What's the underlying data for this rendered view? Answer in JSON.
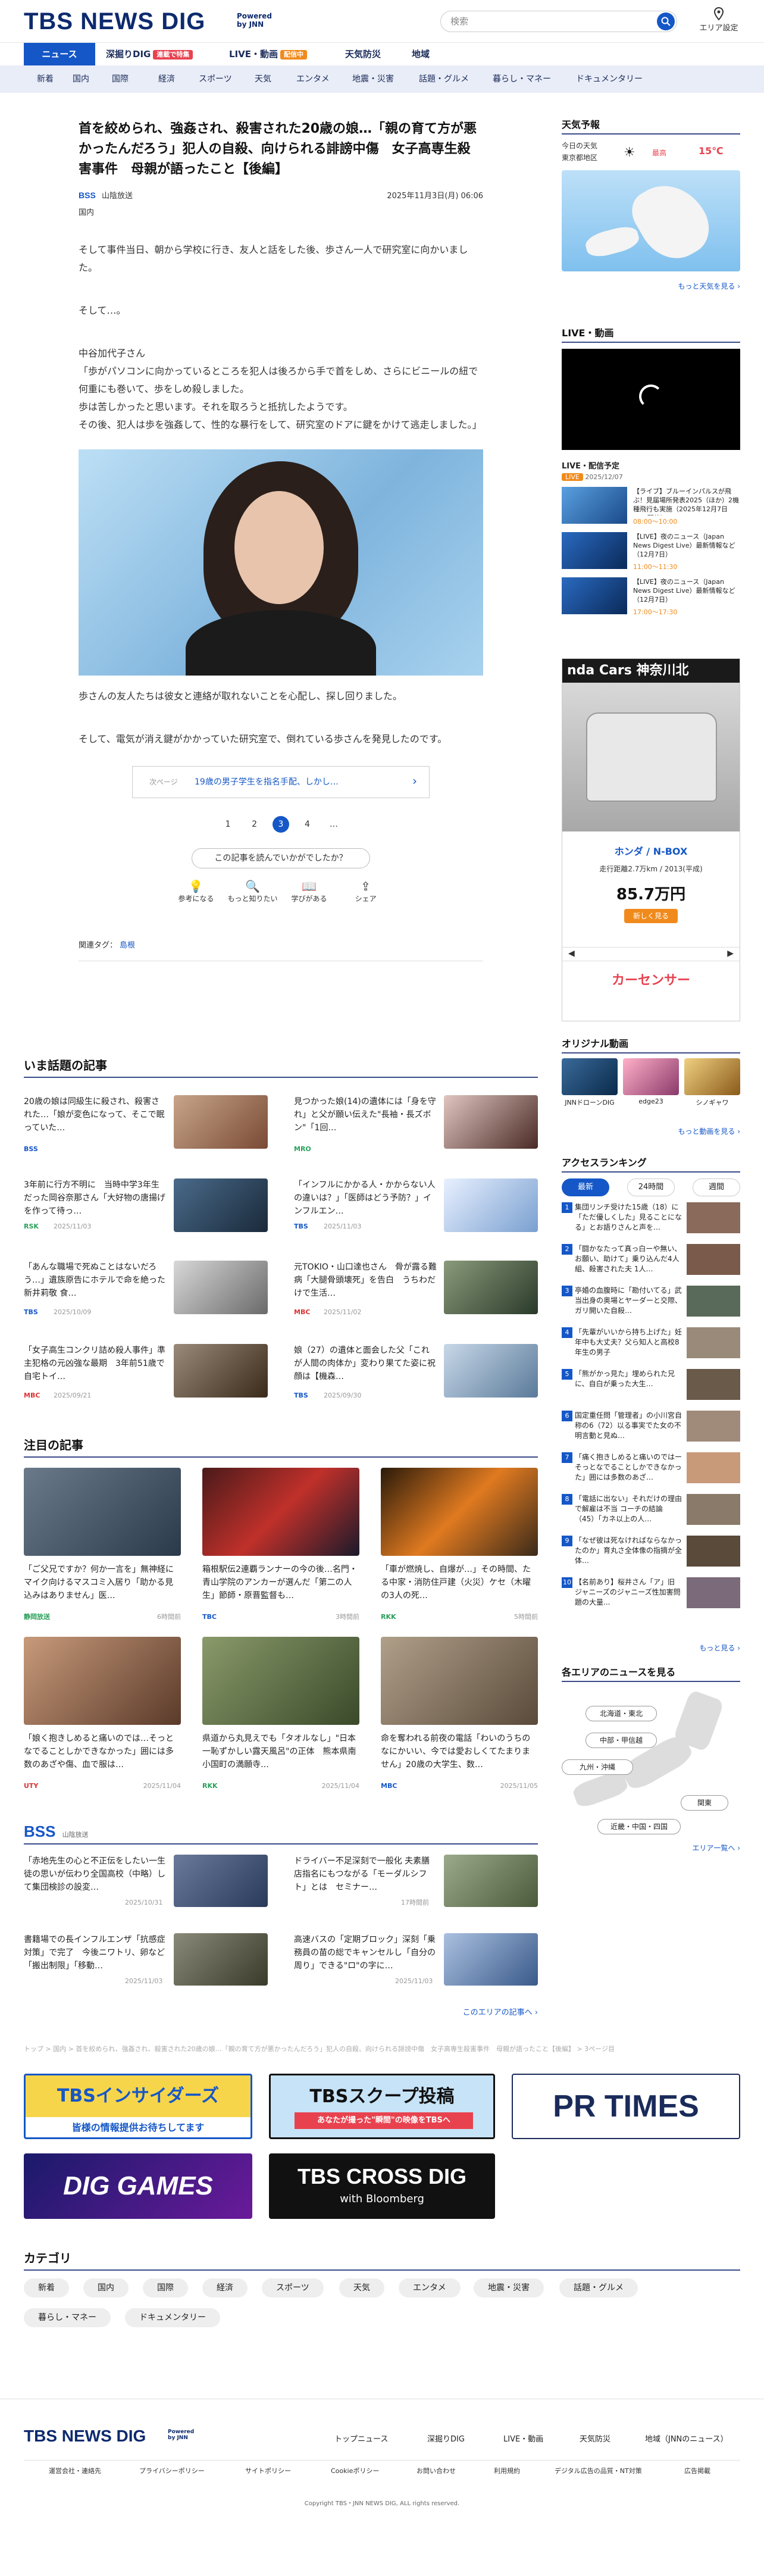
{
  "header": {
    "logo": "TBS NEWS DIG",
    "powered_by": "Powered by JNN",
    "search_placeholder": "検索",
    "area_setting": "エリア設定"
  },
  "nav1": [
    {
      "label": "ニュース"
    },
    {
      "label": "深掘りDIG",
      "badge": "連載で特集"
    },
    {
      "label": "LIVE・動画",
      "badge": "配信中"
    },
    {
      "label": "天気防災"
    },
    {
      "label": "地域"
    }
  ],
  "nav2": [
    "新着",
    "国内",
    "国際",
    "経済",
    "スポーツ",
    "天気",
    "エンタメ",
    "地震・災害",
    "話題・グルメ",
    "暮らし・マネー",
    "ドキュメンタリー"
  ],
  "article": {
    "title": "首を絞められ、強姦され、殺害された20歳の娘…「親の育て方が悪かったんだろう」犯人の自殺、向けられる誹謗中傷　女子高専生殺害事件　母親が語ったこと【後編】",
    "source_logo": "BSS",
    "source": "山陰放送",
    "date": "2025年11月3日(月) 06:06",
    "category": "国内",
    "p1": "そして事件当日、朝から学校に行き、友人と話をした後、歩さん一人で研究室に向かいました。",
    "p2": "そして…。",
    "p3": "中谷加代子さん\n「歩がパソコンに向かっているところを犯人は後ろから手で首をしめ、さらにビニールの紐で何重にも巻いて、歩をしめ殺しました。\n歩は苦しかったと思います。それを取ろうと抵抗したようです。\nその後、犯人は歩を強姦して、性的な暴行をして、研究室のドアに鍵をかけて逃走しました。」",
    "p4": "歩さんの友人たちは彼女と連絡が取れないことを心配し、探し回りました。",
    "p5": "そして、電気が消え鍵がかかっていた研究室で、倒れている歩さんを発見したのです。",
    "next_label": "次ページ",
    "next_text": "19歳の男子学生を指名手配、しかし…",
    "pages": [
      "1",
      "2",
      "3",
      "4",
      "…"
    ],
    "current_page": "3",
    "feedback_question": "この記事を読んでいかがでしたか？",
    "reactions": [
      "参考になる",
      "もっと知りたい",
      "学びがある",
      "シェア"
    ],
    "tags_label": "関連タグ：",
    "tag": "島根"
  },
  "trending": {
    "title": "いま話題の記事",
    "items": [
      {
        "text": "20歳の娘は同級生に殺され、殺害された…「娘が変色になって、そこで眠っていた…",
        "src": "BSS",
        "date": "2025/11/03"
      },
      {
        "text": "見つかった娘(14)の遺体には「身を守れ」と父が願い伝えた\"長袖・長ズボン\"「1回…",
        "src": "MRO",
        "date": "2025/10/31"
      },
      {
        "text": "3年前に行方不明に　当時中学3年生だった岡谷奈那さん「大好物の唐揚げを作って待っ…",
        "src": "RSK",
        "date": "2025/11/03"
      },
      {
        "text": "「インフルにかかる人・かからない人の違いは？」「医師はどう予防？」インフルエン…",
        "src": "TBS",
        "date": "2025/11/03"
      },
      {
        "text": "「あんな職場で死ぬことはないだろう…」遺族原告にホテルで命を絶った新井莉敬 食…",
        "src": "TBS",
        "date": "2025/10/09"
      },
      {
        "text": "元TOKIO・山口達也さん　骨が露る難病「大腿骨頭壊死」を告白　うちわだけで生活…",
        "src": "MBC",
        "date": "2025/11/02"
      },
      {
        "text": "「女子高生コンクリ詰め殺人事件」準主犯格の元凶強な最期　3年前51歳で自宅トイ…",
        "src": "MBC",
        "date": "2025/09/21"
      },
      {
        "text": "娘（27）の遺体と面会した父「これが人間の肉体か」変わり果てた姿に祝顔は【機森…",
        "src": "TBS",
        "date": "2025/09/30"
      }
    ]
  },
  "featured": {
    "title": "注目の記事",
    "items": [
      {
        "text": "「ご父兄ですか？何か一言を」無神経にマイク向けるマスコミ入居り「助かる見込みはありません」医…",
        "src": "静岡放送",
        "date": "6時間前"
      },
      {
        "text": "箱根駅伝2連覇ランナーの今の後…名門・青山学院のアンカーが選んだ「第二の人生」節師・原晋監督も…",
        "src": "TBC",
        "date": "3時間前"
      },
      {
        "text": "「車が燃焼し、自爆が…」その時間、たる中家・消防住戸建（火災）ケセ（木曜の3人の死…",
        "src": "RKK",
        "date": "5時間前"
      },
      {
        "text": "「娘く抱きしめると痛いのでは…そっとなでることしかできなかった」囲には多数のあざや傷、血で服は…",
        "src": "UTY",
        "date": "2025/11/04"
      },
      {
        "text": "県道から丸見えでも「タオルなし」\"日本一恥ずかしい露天風呂\"の正体　熊本県南小国町の満願寺…",
        "src": "RKK",
        "date": "2025/11/04"
      },
      {
        "text": "命を奪われる前夜の電話「わいのうちのなにかいい、今では愛おしくてたまりません」20歳の大学生、数…",
        "src": "MBC",
        "date": "2025/11/05"
      }
    ]
  },
  "local": {
    "logo": "BSS",
    "name": "山陰放送",
    "items": [
      {
        "text": "「赤地先生の心と不正伝をしたい一生徒の思いが伝わり全国高校（中略）して集団検診の設変…",
        "date": "2025/10/31"
      },
      {
        "text": "ドライバー不足深刻で一般化 夫素膳店指名にもつながる「モーダルシフト」とは　セミナー…",
        "date": "17時間前"
      },
      {
        "text": "書籍場での長インフルエンザ「抗感症対策」で完了　今後ニワトリ、卵など「搬出制限」「移動…",
        "date": "2025/11/03"
      },
      {
        "text": "高速バスの「定期ブロック」深刻「乗務員の苗の総でキャンセルし「自分の周り」できる\"ロ\"の字に…",
        "date": "2025/11/03"
      }
    ],
    "more": "このエリアの記事へ ›"
  },
  "breadcrumb": "トップ > 国内 > 首を絞められ、強姦され、殺害された20歳の娘…「親の育て方が悪かったんだろう」犯人の自殺、向けられる誹謗中傷　女子高専生殺害事件　母親が語ったこと【後編】 > 3ページ目",
  "banners": [
    {
      "name": "TBSインサイダーズ",
      "sub": "皆様の情報提供お待ちしてます"
    },
    {
      "name": "TBSスクープ投稿",
      "sub": "あなたが撮った\"瞬間\"の映像をTBSへ"
    },
    {
      "name": "PR TIMES",
      "sub": ""
    },
    {
      "name": "DIG GAMES",
      "sub": ""
    },
    {
      "name": "TBS CROSS DIG",
      "sub": "with Bloomberg"
    }
  ],
  "category_section": {
    "title": "カテゴリ",
    "items": [
      "新着",
      "国内",
      "国際",
      "経済",
      "スポーツ",
      "天気",
      "エンタメ",
      "地震・災害",
      "話題・グルメ",
      "暮らし・マネー",
      "ドキュメンタリー"
    ]
  },
  "weather": {
    "title": "天気予報",
    "today": "今日の天気",
    "region": "東京都地区",
    "hi_label": "最高",
    "hi": "15℃",
    "lo_label": "最低",
    "more": "もっと天気を見る ›"
  },
  "live": {
    "title": "LIVE・動画",
    "sub": "LIVE・配信予定",
    "tag_live": "LIVE",
    "date": "2025/12/07",
    "items": [
      {
        "text": "【ライブ】ブルーインパルスが飛ぶ！見届場所発表2025（ほか）2機種飛行も実施（2025年12月7日 LIVE配信）",
        "time": "08:00〜10:00"
      },
      {
        "text": "【LIVE】夜のニュース（Japan News Digest Live）最新情報など（12月7日）",
        "time": "11:00〜11:30"
      },
      {
        "text": "【LIVE】夜のニュース（Japan News Digest Live）最新情報など（12月7日）",
        "time": "17:00〜17:30"
      }
    ]
  },
  "ad": {
    "headline": "nda Cars 神奈川北",
    "model": "ホンダ / N-BOX",
    "spec": "走行距離2.7万km / 2013(平成)",
    "price": "85.7万円",
    "cta": "新しく見る",
    "brand": "カーセンサー"
  },
  "original_video": {
    "title": "オリジナル動画",
    "items": [
      "JNNドローンDIG",
      "edge23",
      "シノギャワ"
    ],
    "more": "もっと動画を見る ›"
  },
  "ranking": {
    "title": "アクセスランキング",
    "tabs": [
      "最新",
      "24時間",
      "週間"
    ],
    "items": [
      {
        "text": "集団リンチ受けた15歳（18）に「ただ優しくした」見ることになる」とお語りさんと声を…"
      },
      {
        "text": "「闘かなたって真っ白ーや無い、お願い、助けて」乗り込んだ4人組、殺害された夫 1人…"
      },
      {
        "text": "亭婚の血腹時に「勘付いてる」武当出身の奥場とヤーダーと交際、ガリ開いた自殺…"
      },
      {
        "text": "「先輩がいいから持ち上げた」妊年中も大丈夫？父ら知人と高校8年生の男子"
      },
      {
        "text": "「熊がかっ見た」埋められた兄に、自白が乗った大生…"
      },
      {
        "text": "国定重任問「管理者」の小川宮自称の6（72）以る事実でた女の不明言動と見ぬ…"
      },
      {
        "text": "「痛く抱きしめると痛いのではーそっとなでることしかできなかった」囲には多数のあざ…"
      },
      {
        "text": "「電話に出ない」それだけの理由で解雇は不当 コーチの結論（45）「カネ以上の人…"
      },
      {
        "text": "「なぜ彼は死なければならなかったのか」育丸さ全体像の指摘が全体…"
      },
      {
        "text": "【名前あり】桜井さん「ア」旧ジャニーズのジャニーズ性加害問題の大量..."
      }
    ],
    "more": "もっと見る ›"
  },
  "area_news": {
    "title": "各エリアのニュースを見る",
    "regions": [
      "北海道・東北",
      "中部・甲信越",
      "九州・沖縄",
      "関東",
      "近畿・中国・四国"
    ],
    "more": "エリア一覧へ ›"
  },
  "footer": {
    "logo": "TBS NEWS DIG",
    "powered_by": "Powered by JNN",
    "main_links": [
      "トップニュース",
      "深掘りDIG",
      "LIVE・動画",
      "天気防災",
      "地域（JNNのニュース）"
    ],
    "sub_links": [
      "運営会社・連絡先",
      "プライバシーポリシー",
      "サイトポリシー",
      "Cookieポリシー",
      "お問い合わせ",
      "利用規約",
      "デジタル広告の品質・NT対策",
      "広告掲載"
    ],
    "copyright": "Copyright TBS・JNN NEWS DIG, ALL rights reserved."
  }
}
